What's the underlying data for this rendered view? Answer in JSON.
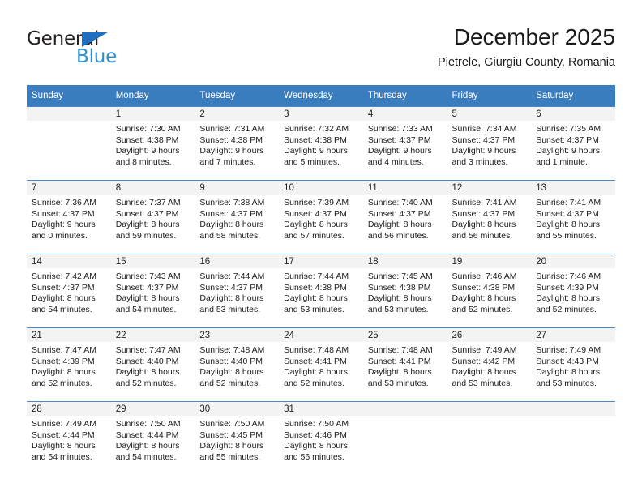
{
  "brand": {
    "name_part1": "General",
    "name_part2": "Blue",
    "triangle_color": "#1f6fc0",
    "blue_color": "#2b8fd4"
  },
  "header": {
    "title": "December 2025",
    "subtitle": "Pietrele, Giurgiu County, Romania"
  },
  "theme": {
    "header_row_bg": "#3a7dbf",
    "row_divider": "#4a87c6",
    "daynum_band_bg": "#f3f3f3"
  },
  "weekdays": [
    "Sunday",
    "Monday",
    "Tuesday",
    "Wednesday",
    "Thursday",
    "Friday",
    "Saturday"
  ],
  "weeks": [
    [
      {
        "day": "",
        "sunrise": "",
        "sunset": "",
        "daylight1": "",
        "daylight2": ""
      },
      {
        "day": "1",
        "sunrise": "Sunrise: 7:30 AM",
        "sunset": "Sunset: 4:38 PM",
        "daylight1": "Daylight: 9 hours",
        "daylight2": "and 8 minutes."
      },
      {
        "day": "2",
        "sunrise": "Sunrise: 7:31 AM",
        "sunset": "Sunset: 4:38 PM",
        "daylight1": "Daylight: 9 hours",
        "daylight2": "and 7 minutes."
      },
      {
        "day": "3",
        "sunrise": "Sunrise: 7:32 AM",
        "sunset": "Sunset: 4:38 PM",
        "daylight1": "Daylight: 9 hours",
        "daylight2": "and 5 minutes."
      },
      {
        "day": "4",
        "sunrise": "Sunrise: 7:33 AM",
        "sunset": "Sunset: 4:37 PM",
        "daylight1": "Daylight: 9 hours",
        "daylight2": "and 4 minutes."
      },
      {
        "day": "5",
        "sunrise": "Sunrise: 7:34 AM",
        "sunset": "Sunset: 4:37 PM",
        "daylight1": "Daylight: 9 hours",
        "daylight2": "and 3 minutes."
      },
      {
        "day": "6",
        "sunrise": "Sunrise: 7:35 AM",
        "sunset": "Sunset: 4:37 PM",
        "daylight1": "Daylight: 9 hours",
        "daylight2": "and 1 minute."
      }
    ],
    [
      {
        "day": "7",
        "sunrise": "Sunrise: 7:36 AM",
        "sunset": "Sunset: 4:37 PM",
        "daylight1": "Daylight: 9 hours",
        "daylight2": "and 0 minutes."
      },
      {
        "day": "8",
        "sunrise": "Sunrise: 7:37 AM",
        "sunset": "Sunset: 4:37 PM",
        "daylight1": "Daylight: 8 hours",
        "daylight2": "and 59 minutes."
      },
      {
        "day": "9",
        "sunrise": "Sunrise: 7:38 AM",
        "sunset": "Sunset: 4:37 PM",
        "daylight1": "Daylight: 8 hours",
        "daylight2": "and 58 minutes."
      },
      {
        "day": "10",
        "sunrise": "Sunrise: 7:39 AM",
        "sunset": "Sunset: 4:37 PM",
        "daylight1": "Daylight: 8 hours",
        "daylight2": "and 57 minutes."
      },
      {
        "day": "11",
        "sunrise": "Sunrise: 7:40 AM",
        "sunset": "Sunset: 4:37 PM",
        "daylight1": "Daylight: 8 hours",
        "daylight2": "and 56 minutes."
      },
      {
        "day": "12",
        "sunrise": "Sunrise: 7:41 AM",
        "sunset": "Sunset: 4:37 PM",
        "daylight1": "Daylight: 8 hours",
        "daylight2": "and 56 minutes."
      },
      {
        "day": "13",
        "sunrise": "Sunrise: 7:41 AM",
        "sunset": "Sunset: 4:37 PM",
        "daylight1": "Daylight: 8 hours",
        "daylight2": "and 55 minutes."
      }
    ],
    [
      {
        "day": "14",
        "sunrise": "Sunrise: 7:42 AM",
        "sunset": "Sunset: 4:37 PM",
        "daylight1": "Daylight: 8 hours",
        "daylight2": "and 54 minutes."
      },
      {
        "day": "15",
        "sunrise": "Sunrise: 7:43 AM",
        "sunset": "Sunset: 4:37 PM",
        "daylight1": "Daylight: 8 hours",
        "daylight2": "and 54 minutes."
      },
      {
        "day": "16",
        "sunrise": "Sunrise: 7:44 AM",
        "sunset": "Sunset: 4:37 PM",
        "daylight1": "Daylight: 8 hours",
        "daylight2": "and 53 minutes."
      },
      {
        "day": "17",
        "sunrise": "Sunrise: 7:44 AM",
        "sunset": "Sunset: 4:38 PM",
        "daylight1": "Daylight: 8 hours",
        "daylight2": "and 53 minutes."
      },
      {
        "day": "18",
        "sunrise": "Sunrise: 7:45 AM",
        "sunset": "Sunset: 4:38 PM",
        "daylight1": "Daylight: 8 hours",
        "daylight2": "and 53 minutes."
      },
      {
        "day": "19",
        "sunrise": "Sunrise: 7:46 AM",
        "sunset": "Sunset: 4:38 PM",
        "daylight1": "Daylight: 8 hours",
        "daylight2": "and 52 minutes."
      },
      {
        "day": "20",
        "sunrise": "Sunrise: 7:46 AM",
        "sunset": "Sunset: 4:39 PM",
        "daylight1": "Daylight: 8 hours",
        "daylight2": "and 52 minutes."
      }
    ],
    [
      {
        "day": "21",
        "sunrise": "Sunrise: 7:47 AM",
        "sunset": "Sunset: 4:39 PM",
        "daylight1": "Daylight: 8 hours",
        "daylight2": "and 52 minutes."
      },
      {
        "day": "22",
        "sunrise": "Sunrise: 7:47 AM",
        "sunset": "Sunset: 4:40 PM",
        "daylight1": "Daylight: 8 hours",
        "daylight2": "and 52 minutes."
      },
      {
        "day": "23",
        "sunrise": "Sunrise: 7:48 AM",
        "sunset": "Sunset: 4:40 PM",
        "daylight1": "Daylight: 8 hours",
        "daylight2": "and 52 minutes."
      },
      {
        "day": "24",
        "sunrise": "Sunrise: 7:48 AM",
        "sunset": "Sunset: 4:41 PM",
        "daylight1": "Daylight: 8 hours",
        "daylight2": "and 52 minutes."
      },
      {
        "day": "25",
        "sunrise": "Sunrise: 7:48 AM",
        "sunset": "Sunset: 4:41 PM",
        "daylight1": "Daylight: 8 hours",
        "daylight2": "and 53 minutes."
      },
      {
        "day": "26",
        "sunrise": "Sunrise: 7:49 AM",
        "sunset": "Sunset: 4:42 PM",
        "daylight1": "Daylight: 8 hours",
        "daylight2": "and 53 minutes."
      },
      {
        "day": "27",
        "sunrise": "Sunrise: 7:49 AM",
        "sunset": "Sunset: 4:43 PM",
        "daylight1": "Daylight: 8 hours",
        "daylight2": "and 53 minutes."
      }
    ],
    [
      {
        "day": "28",
        "sunrise": "Sunrise: 7:49 AM",
        "sunset": "Sunset: 4:44 PM",
        "daylight1": "Daylight: 8 hours",
        "daylight2": "and 54 minutes."
      },
      {
        "day": "29",
        "sunrise": "Sunrise: 7:50 AM",
        "sunset": "Sunset: 4:44 PM",
        "daylight1": "Daylight: 8 hours",
        "daylight2": "and 54 minutes."
      },
      {
        "day": "30",
        "sunrise": "Sunrise: 7:50 AM",
        "sunset": "Sunset: 4:45 PM",
        "daylight1": "Daylight: 8 hours",
        "daylight2": "and 55 minutes."
      },
      {
        "day": "31",
        "sunrise": "Sunrise: 7:50 AM",
        "sunset": "Sunset: 4:46 PM",
        "daylight1": "Daylight: 8 hours",
        "daylight2": "and 56 minutes."
      },
      {
        "day": "",
        "sunrise": "",
        "sunset": "",
        "daylight1": "",
        "daylight2": ""
      },
      {
        "day": "",
        "sunrise": "",
        "sunset": "",
        "daylight1": "",
        "daylight2": ""
      },
      {
        "day": "",
        "sunrise": "",
        "sunset": "",
        "daylight1": "",
        "daylight2": ""
      }
    ]
  ]
}
